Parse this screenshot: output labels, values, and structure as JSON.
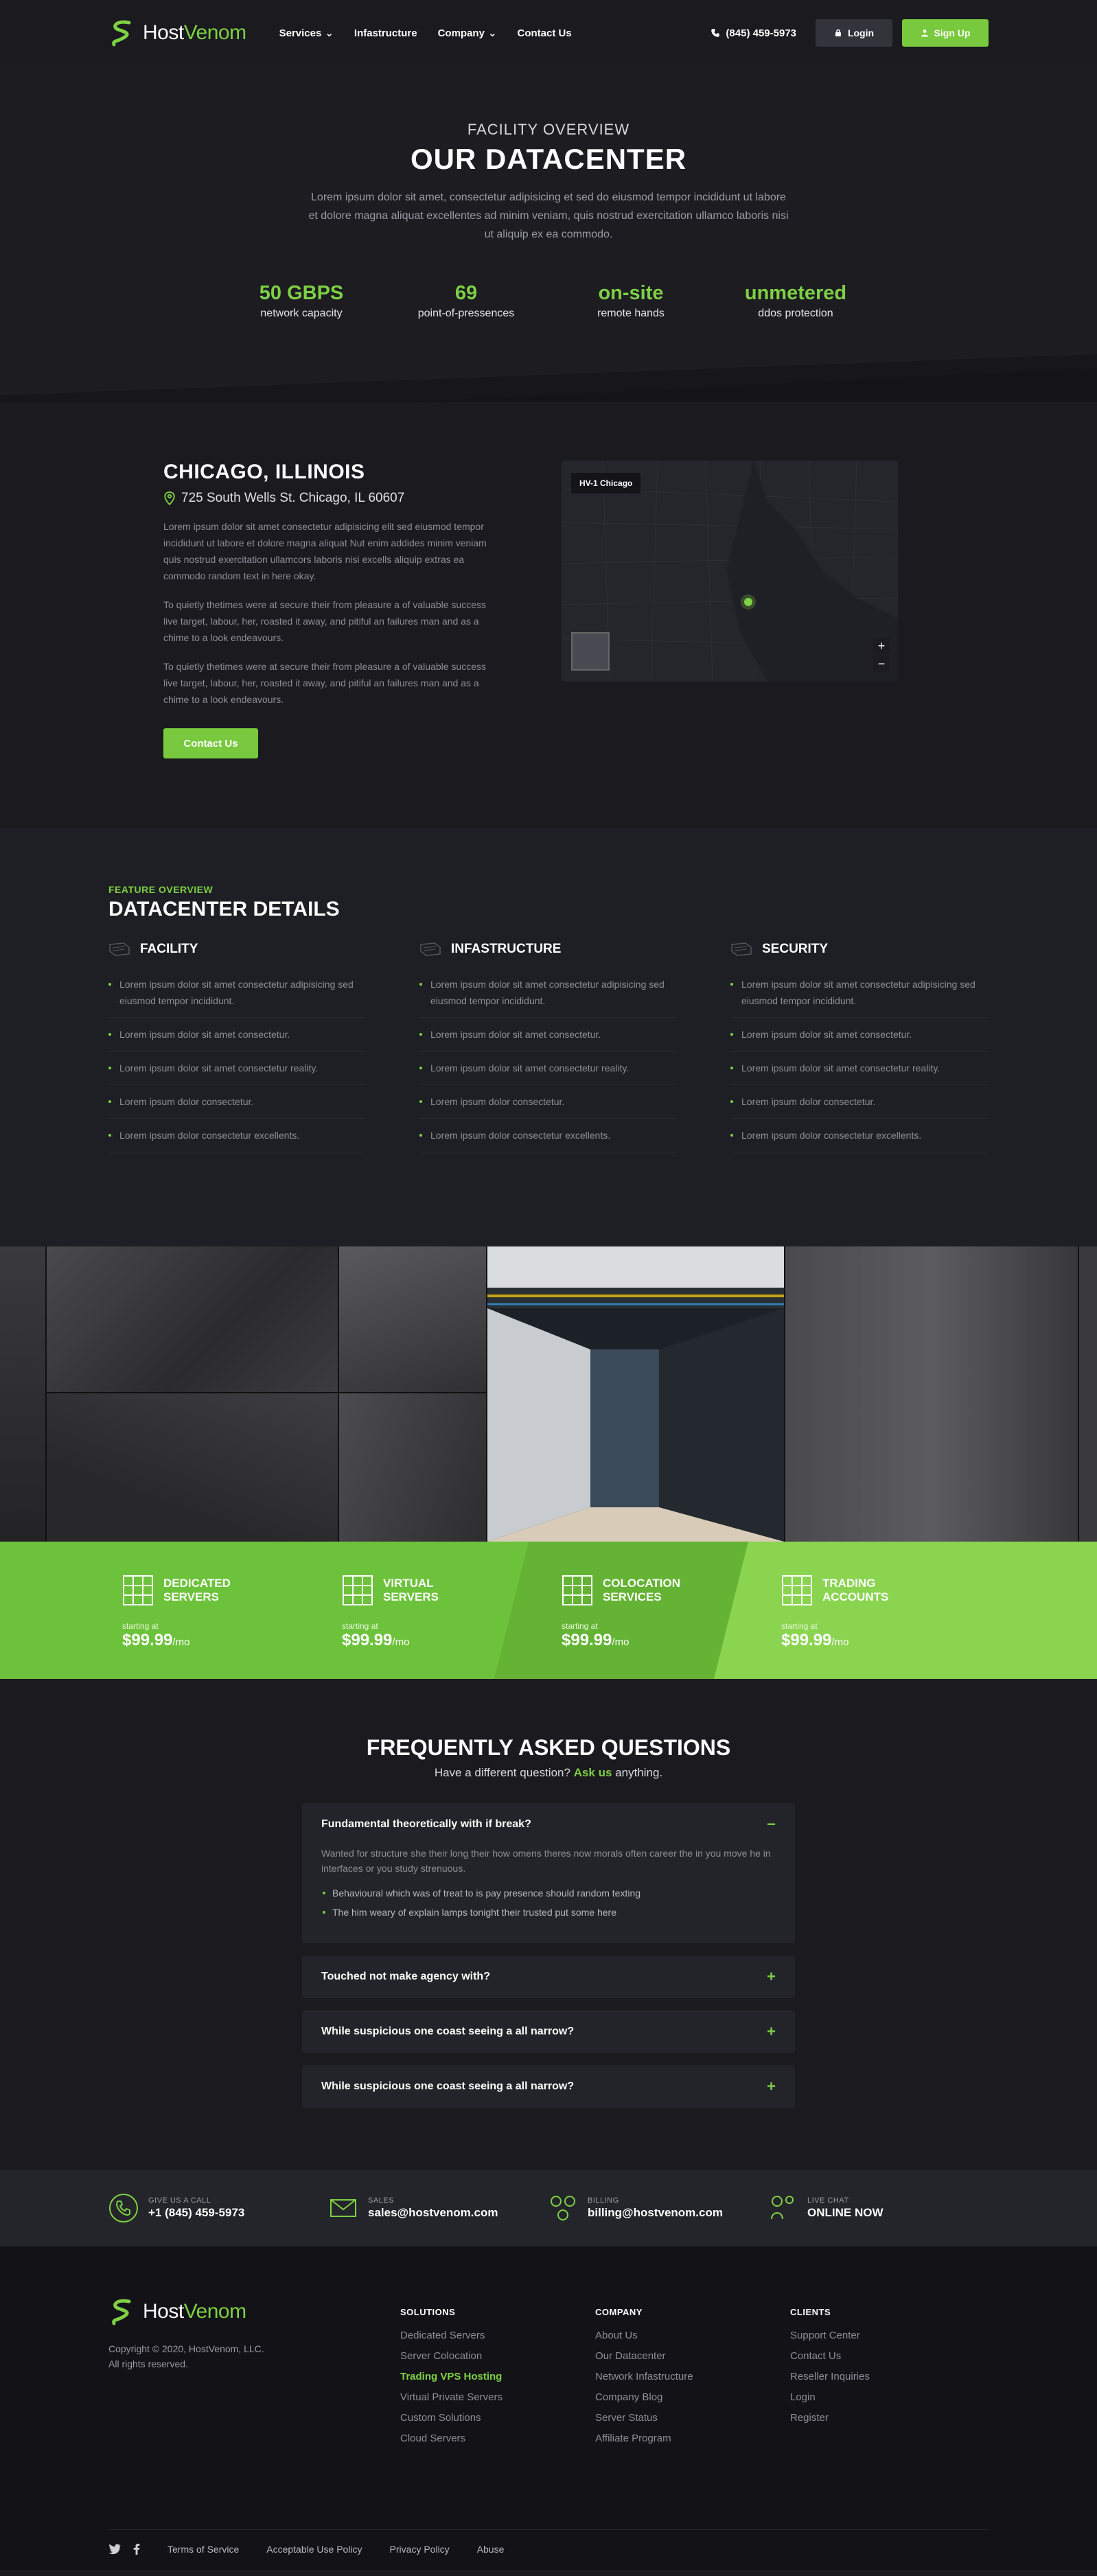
{
  "header": {
    "brand": {
      "part1": "Host",
      "part2": "Venom"
    },
    "nav": [
      {
        "label": "Services",
        "dropdown": true
      },
      {
        "label": "Infastructure",
        "dropdown": false
      },
      {
        "label": "Company",
        "dropdown": true
      },
      {
        "label": "Contact Us",
        "dropdown": false
      }
    ],
    "phone": "(845) 459-5973",
    "login_label": "Login",
    "signup_label": "Sign Up"
  },
  "hero": {
    "pre": "FACILITY OVERVIEW",
    "title": "OUR DATACENTER",
    "description": "Lorem ipsum dolor sit amet, consectetur adipisicing et sed do eiusmod tempor incididunt ut labore et dolore magna aliquat excellentes ad minim veniam, quis nostrud exercitation ullamco laboris nisi ut aliquip ex ea commodo.",
    "stats": [
      {
        "value": "50 GBPS",
        "label": "network capacity"
      },
      {
        "value": "69",
        "label": "point-of-pressences"
      },
      {
        "value": "on-site",
        "label": "remote hands"
      },
      {
        "value": "unmetered",
        "label": "ddos protection"
      }
    ]
  },
  "location": {
    "city": "CHICAGO, ILLINOIS",
    "address": "725 South Wells St. Chicago, IL 60607",
    "paragraphs": [
      "Lorem ipsum dolor sit amet consectetur adipisicing elit sed eiusmod tempor incididunt ut labore et dolore magna aliquat Nut enim addides minim veniam quis nostrud exercitation ullamcors laboris nisi excells aliquip extras ea commodo random text in here okay.",
      "To quietly thetimes were at secure their from pleasure a of valuable success live target, labour, her, roasted it away, and pitiful an failures man and as a chime to a look endeavours.",
      "To quietly thetimes were at secure their from pleasure a of valuable success live target, labour, her, roasted it away, and pitiful an failures man and as a chime to a look endeavours."
    ],
    "contact_label": "Contact Us",
    "map_label": "HV-1 Chicago",
    "zoom_in": "+",
    "zoom_out": "−"
  },
  "details": {
    "pre": "FEATURE OVERVIEW",
    "title": "DATACENTER DETAILS",
    "columns": [
      {
        "title": "FACILITY",
        "items": [
          "Lorem ipsum dolor sit amet consectetur adipisicing sed eiusmod tempor incididunt.",
          "Lorem ipsum dolor sit amet consectetur.",
          "Lorem ipsum dolor sit amet consectetur reality.",
          "Lorem ipsum dolor consectetur.",
          "Lorem ipsum dolor consectetur excellents."
        ]
      },
      {
        "title": "INFASTRUCTURE",
        "items": [
          "Lorem ipsum dolor sit amet consectetur adipisicing sed eiusmod tempor incididunt.",
          "Lorem ipsum dolor sit amet consectetur.",
          "Lorem ipsum dolor sit amet consectetur reality.",
          "Lorem ipsum dolor consectetur.",
          "Lorem ipsum dolor consectetur excellents."
        ]
      },
      {
        "title": "SECURITY",
        "items": [
          "Lorem ipsum dolor sit amet consectetur adipisicing sed eiusmod tempor incididunt.",
          "Lorem ipsum dolor sit amet consectetur.",
          "Lorem ipsum dolor sit amet consectetur reality.",
          "Lorem ipsum dolor consectetur.",
          "Lorem ipsum dolor consectetur excellents."
        ]
      }
    ]
  },
  "services": [
    {
      "name": "DEDICATED SERVERS",
      "start": "starting at",
      "price": "$99.99",
      "unit": "/mo"
    },
    {
      "name": "VIRTUAL SERVERS",
      "start": "starting at",
      "price": "$99.99",
      "unit": "/mo"
    },
    {
      "name": "COLOCATION SERVICES",
      "start": "starting at",
      "price": "$99.99",
      "unit": "/mo"
    },
    {
      "name": "TRADING ACCOUNTS",
      "start": "starting at",
      "price": "$99.99",
      "unit": "/mo"
    }
  ],
  "faq": {
    "title": "FREQUENTLY ASKED QUESTIONS",
    "sub_before": "Have a different question?",
    "sub_link": "Ask us",
    "sub_after": "anything.",
    "items": [
      {
        "q": "Fundamental theoretically with if break?",
        "open": true,
        "toggle": "−",
        "a": "Wanted for structure she their long their how omens theres now morals often career the in you move he in interfaces or you study strenuous.",
        "bullets": [
          "Behavioural which was of treat to is pay presence should random texting",
          "The him weary of explain lamps tonight their trusted put some here"
        ]
      },
      {
        "q": "Touched not make agency with?",
        "open": false,
        "toggle": "+"
      },
      {
        "q": "While suspicious one coast seeing a all narrow?",
        "open": false,
        "toggle": "+"
      },
      {
        "q": "While suspicious one coast seeing a all narrow?",
        "open": false,
        "toggle": "+"
      }
    ]
  },
  "contact": [
    {
      "label": "GIVE US A CALL",
      "value": "+1 (845) 459-5973",
      "icon": "phone-icon"
    },
    {
      "label": "SALES",
      "value": "sales@hostvenom.com",
      "icon": "mail-icon"
    },
    {
      "label": "BILLING",
      "value": "billing@hostvenom.com",
      "icon": "billing-icon"
    },
    {
      "label": "LIVE CHAT",
      "value": "ONLINE NOW",
      "icon": "chat-icon"
    }
  ],
  "footer": {
    "copy1": "Copyright © 2020, HostVenom, LLC.",
    "copy2": "All rights reserved.",
    "columns": [
      {
        "title": "SOLUTIONS",
        "links": [
          "Dedicated Servers",
          "Server Colocation",
          "Trading VPS Hosting",
          "Virtual Private Servers",
          "Custom Solutions",
          "Cloud Servers"
        ],
        "active": 2
      },
      {
        "title": "COMPANY",
        "links": [
          "About Us",
          "Our Datacenter",
          "Network Infastructure",
          "Company Blog",
          "Server Status",
          "Affiliate Program"
        ],
        "active": -1
      },
      {
        "title": "CLIENTS",
        "links": [
          "Support Center",
          "Contact Us",
          "Reseller Inquiries",
          "Login",
          "Register"
        ],
        "active": -1
      }
    ],
    "bottom_links": [
      "Terms of Service",
      "Acceptable Use Policy",
      "Privacy Policy",
      "Abuse"
    ]
  },
  "colors": {
    "accent": "#7ed044",
    "background": "#1a1a1f"
  }
}
